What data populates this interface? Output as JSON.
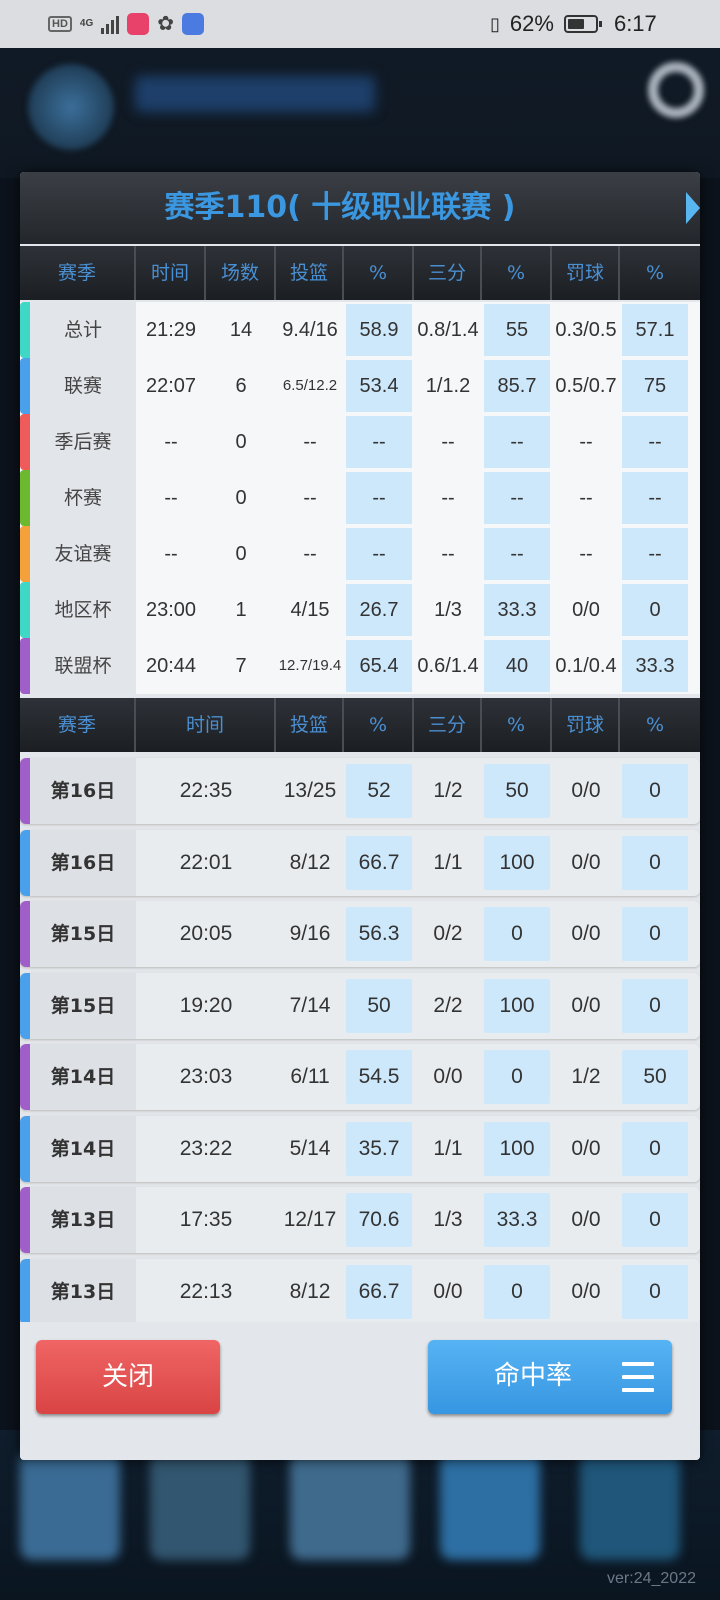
{
  "statusbar": {
    "hd": "HD",
    "network": "4G",
    "battery_percent": "62%",
    "battery_level": 0.62,
    "time": "6:17"
  },
  "version": "ver:24_2022",
  "dialog": {
    "title": "赛季110( 十级职业联赛 )",
    "summary_headers": [
      "赛季",
      "时间",
      "场数",
      "投篮",
      "%",
      "三分",
      "%",
      "罚球",
      "%"
    ],
    "summary_rows": [
      {
        "label": "总计",
        "color": "#3fd8c6",
        "cells": [
          "21:29",
          "14",
          "9.4/16",
          "58.9",
          "0.8/1.4",
          "55",
          "0.3/0.5",
          "57.1"
        ]
      },
      {
        "label": "联赛",
        "color": "#4aa0ea",
        "cells": [
          "22:07",
          "6",
          "6.5/12.2",
          "53.4",
          "1/1.2",
          "85.7",
          "0.5/0.7",
          "75"
        ]
      },
      {
        "label": "季后赛",
        "color": "#ef5a5a",
        "cells": [
          "--",
          "0",
          "--",
          "--",
          "--",
          "--",
          "--",
          "--"
        ]
      },
      {
        "label": "杯赛",
        "color": "#6cb82f",
        "cells": [
          "--",
          "0",
          "--",
          "--",
          "--",
          "--",
          "--",
          "--"
        ]
      },
      {
        "label": "友谊赛",
        "color": "#f4a13b",
        "cells": [
          "--",
          "0",
          "--",
          "--",
          "--",
          "--",
          "--",
          "--"
        ]
      },
      {
        "label": "地区杯",
        "color": "#3fd8c6",
        "cells": [
          "23:00",
          "1",
          "4/15",
          "26.7",
          "1/3",
          "33.3",
          "0/0",
          "0"
        ]
      },
      {
        "label": "联盟杯",
        "color": "#a05ec8",
        "cells": [
          "20:44",
          "7",
          "12.7/19.4",
          "65.4",
          "0.6/1.4",
          "40",
          "0.1/0.4",
          "33.3"
        ]
      }
    ],
    "game_headers": [
      "赛季",
      "时间",
      "投篮",
      "%",
      "三分",
      "%",
      "罚球",
      "%"
    ],
    "game_rows": [
      {
        "label": "第16日",
        "color": "#a05ec8",
        "cells": [
          "22:35",
          "13/25",
          "52",
          "1/2",
          "50",
          "0/0",
          "0"
        ]
      },
      {
        "label": "第16日",
        "color": "#4aa0ea",
        "cells": [
          "22:01",
          "8/12",
          "66.7",
          "1/1",
          "100",
          "0/0",
          "0"
        ]
      },
      {
        "label": "第15日",
        "color": "#a05ec8",
        "cells": [
          "20:05",
          "9/16",
          "56.3",
          "0/2",
          "0",
          "0/0",
          "0"
        ]
      },
      {
        "label": "第15日",
        "color": "#4aa0ea",
        "cells": [
          "19:20",
          "7/14",
          "50",
          "2/2",
          "100",
          "0/0",
          "0"
        ]
      },
      {
        "label": "第14日",
        "color": "#a05ec8",
        "cells": [
          "23:03",
          "6/11",
          "54.5",
          "0/0",
          "0",
          "1/2",
          "50"
        ]
      },
      {
        "label": "第14日",
        "color": "#4aa0ea",
        "cells": [
          "23:22",
          "5/14",
          "35.7",
          "1/1",
          "100",
          "0/0",
          "0"
        ]
      },
      {
        "label": "第13日",
        "color": "#a05ec8",
        "cells": [
          "17:35",
          "12/17",
          "70.6",
          "1/3",
          "33.3",
          "0/0",
          "0"
        ]
      },
      {
        "label": "第13日",
        "color": "#4aa0ea",
        "cells": [
          "22:13",
          "8/12",
          "66.7",
          "0/0",
          "0",
          "0/0",
          "0"
        ]
      }
    ],
    "close_label": "关闭",
    "rate_label": "命中率"
  }
}
